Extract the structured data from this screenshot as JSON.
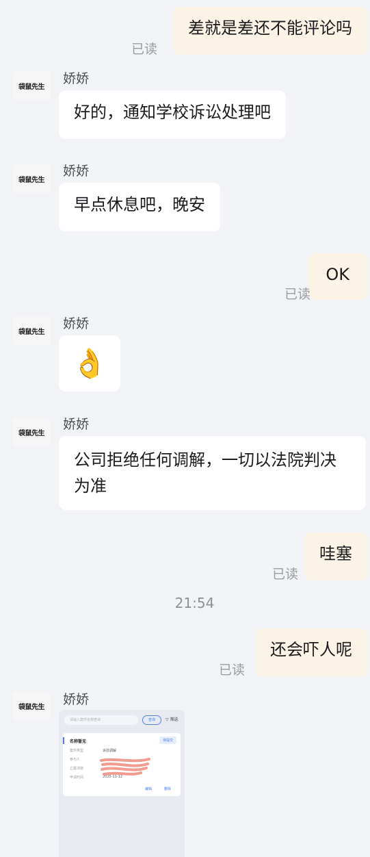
{
  "contact": {
    "name": "娇娇",
    "avatar_text": "袋鼠先生"
  },
  "status": {
    "read": "已读"
  },
  "messages": [
    {
      "dir": "out",
      "text": "差就是差还不能评论吗"
    },
    {
      "dir": "in",
      "text": "好的，通知学校诉讼处理吧"
    },
    {
      "dir": "in",
      "text": "早点休息吧，晚安"
    },
    {
      "dir": "out",
      "text": "OK"
    },
    {
      "dir": "in",
      "emoji": "👌"
    },
    {
      "dir": "in",
      "text": "公司拒绝任何调解，一切以法院判决为准"
    },
    {
      "dir": "out",
      "text": "哇塞"
    },
    {
      "dir": "out",
      "text": "还会吓人呢"
    },
    {
      "dir": "in",
      "image": "screenshot"
    }
  ],
  "timestamp": "21:54",
  "shot": {
    "search_placeholder": "请输入案件名称查询",
    "query_btn": "查询",
    "filter": "筛选",
    "card_title": "名称暂无",
    "badge": "待提交",
    "rows": [
      {
        "label": "案件类型",
        "value": "诉前调解"
      },
      {
        "label": "参与人",
        "value": ""
      },
      {
        "label": "立案法院",
        "value": ""
      },
      {
        "label": "申请时间",
        "value": "2025-11-12"
      }
    ],
    "edit": "编辑",
    "delete": "删除"
  }
}
